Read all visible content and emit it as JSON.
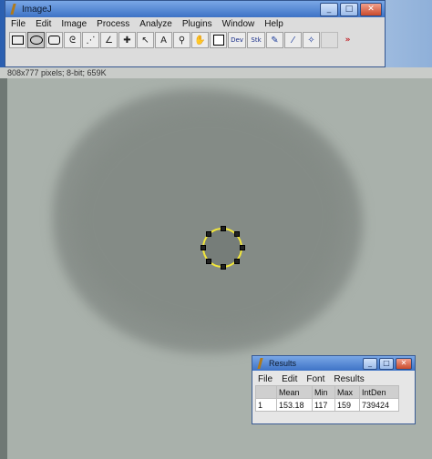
{
  "image_window": {
    "info_text": "808x777 pixels; 8-bit; 659K"
  },
  "imagej_window": {
    "title": "ImageJ",
    "window_buttons": [
      "_",
      "□",
      "✕"
    ],
    "menu": [
      "File",
      "Edit",
      "Image",
      "Process",
      "Analyze",
      "Plugins",
      "Window",
      "Help"
    ],
    "tools": [
      {
        "name": "rectangle-tool",
        "glyph": ""
      },
      {
        "name": "oval-tool",
        "glyph": "",
        "selected": true
      },
      {
        "name": "polygon-tool",
        "glyph": "⬠"
      },
      {
        "name": "freehand-tool",
        "glyph": "ᘓ"
      },
      {
        "name": "line-tool",
        "glyph": "⋰"
      },
      {
        "name": "angle-tool",
        "glyph": "∠"
      },
      {
        "name": "point-tool",
        "glyph": "✚"
      },
      {
        "name": "wand-tool",
        "glyph": "↖"
      },
      {
        "name": "text-tool",
        "glyph": "A"
      },
      {
        "name": "magnifier-tool",
        "glyph": "⚲"
      },
      {
        "name": "hand-tool",
        "glyph": "✋"
      },
      {
        "name": "color-picker-tool",
        "glyph": ""
      },
      {
        "name": "dev-tool",
        "glyph": "Dev"
      },
      {
        "name": "stk-tool",
        "glyph": "Stk"
      },
      {
        "name": "pencil-tool",
        "glyph": "✎"
      },
      {
        "name": "brush-tool",
        "glyph": "⁄"
      },
      {
        "name": "wand-plugin-tool",
        "glyph": "✧"
      },
      {
        "name": "blank-tool",
        "glyph": ""
      },
      {
        "name": "more-tools",
        "glyph": "»"
      }
    ]
  },
  "results_window": {
    "title": "Results",
    "window_buttons": [
      "_",
      "□",
      "✕"
    ],
    "menu": [
      "File",
      "Edit",
      "Font",
      "Results"
    ],
    "headers": [
      "",
      "Mean",
      "Min",
      "Max",
      "IntDen"
    ],
    "rows": [
      [
        "1",
        "153.18",
        "117",
        "159",
        "739424"
      ]
    ]
  },
  "colors": {
    "roi": "#f2e63a",
    "titlebar": "#3e73c6"
  }
}
